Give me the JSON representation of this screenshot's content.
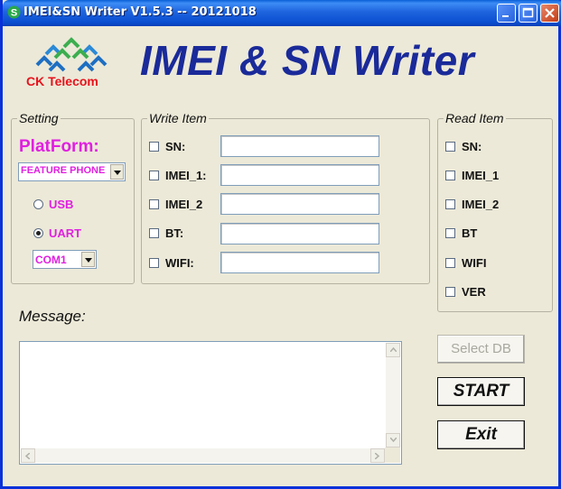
{
  "window": {
    "title": "IMEI&SN Writer V1.5.3 -- 20121018"
  },
  "header": {
    "logo_text": "CK Telecom",
    "app_title": "IMEI & SN Writer"
  },
  "setting": {
    "legend": "Setting",
    "platform_label": "PlatForm:",
    "platform_value": "FEATURE PHONE",
    "usb_label": "USB",
    "uart_label": "UART",
    "selected_connection": "UART",
    "com_value": "COM1"
  },
  "write_item": {
    "legend": "Write Item",
    "items": [
      {
        "label": "SN:",
        "value": "",
        "checked": false
      },
      {
        "label": "IMEI_1:",
        "value": "",
        "checked": false
      },
      {
        "label": "IMEI_2",
        "value": "",
        "checked": false
      },
      {
        "label": "BT:",
        "value": "",
        "checked": false
      },
      {
        "label": "WIFI:",
        "value": "",
        "checked": false
      }
    ]
  },
  "read_item": {
    "legend": "Read Item",
    "items": [
      {
        "label": "SN:",
        "checked": false
      },
      {
        "label": "IMEI_1",
        "checked": false
      },
      {
        "label": "IMEI_2",
        "checked": false
      },
      {
        "label": "BT",
        "checked": false
      },
      {
        "label": "WIFI",
        "checked": false
      },
      {
        "label": "VER",
        "checked": false
      }
    ]
  },
  "message": {
    "label": "Message:",
    "content": ""
  },
  "buttons": {
    "select_db": "Select DB",
    "start": "START",
    "exit": "Exit"
  },
  "colors": {
    "title_bar": "#1e64de",
    "app_title": "#1a2a99",
    "logo_text": "#e8121c",
    "magenta_label": "#e020e0",
    "dialog_bg": "#ece9d8"
  }
}
